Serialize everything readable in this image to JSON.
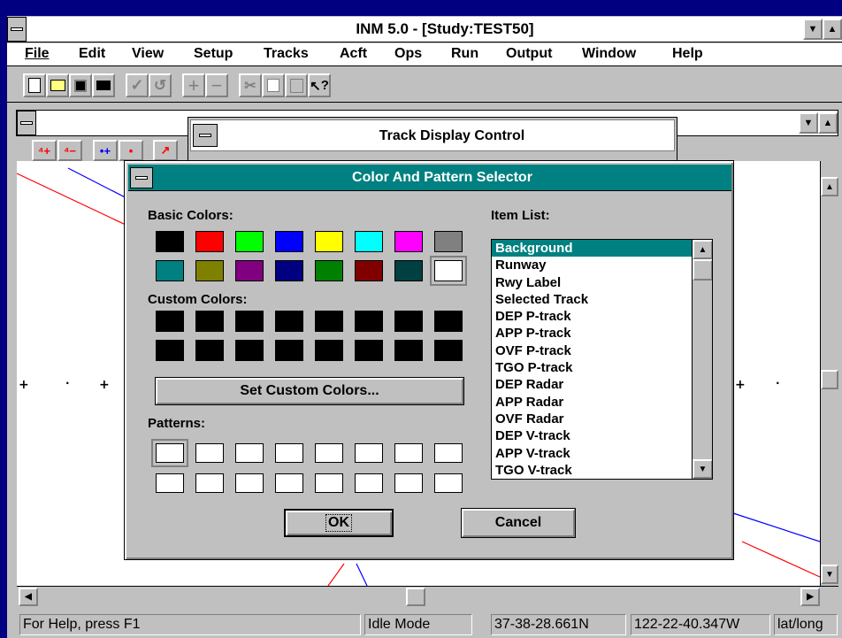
{
  "app": {
    "title": "INM 5.0 - [Study:TEST50]"
  },
  "menu": [
    "File",
    "Edit",
    "View",
    "Setup",
    "Tracks",
    "Acft",
    "Ops",
    "Run",
    "Output",
    "Window",
    "Help"
  ],
  "toolbar": {
    "help_glyph": "?"
  },
  "track_display": {
    "title": "Track Display Control"
  },
  "dialog": {
    "title": "Color And Pattern Selector",
    "basic_colors_label": "Basic Colors:",
    "custom_colors_label": "Custom Colors:",
    "set_custom_label": "Set Custom Colors...",
    "patterns_label": "Patterns:",
    "item_list_label": "Item List:",
    "ok_label": "OK",
    "cancel_label": "Cancel",
    "basic_colors": [
      "#000000",
      "#ff0000",
      "#00ff00",
      "#0000ff",
      "#ffff00",
      "#00ffff",
      "#ff00ff",
      "#808080",
      "#008080",
      "#808000",
      "#800080",
      "#000080",
      "#008000",
      "#800000",
      "#004040",
      "#ffffff"
    ],
    "items": [
      "Background",
      "Runway",
      "Rwy Label",
      "Selected Track",
      "DEP P-track",
      "APP P-track",
      "OVF P-track",
      "TGO P-track",
      "DEP Radar",
      "APP Radar",
      "OVF Radar",
      "DEP V-track",
      "APP V-track",
      "TGO V-track"
    ],
    "selected_item": "Background"
  },
  "statusbar": {
    "help": "For Help, press F1",
    "mode": "Idle Mode",
    "lat": "37-38-28.661N",
    "lon": "122-22-40.347W",
    "units": "lat/long"
  }
}
